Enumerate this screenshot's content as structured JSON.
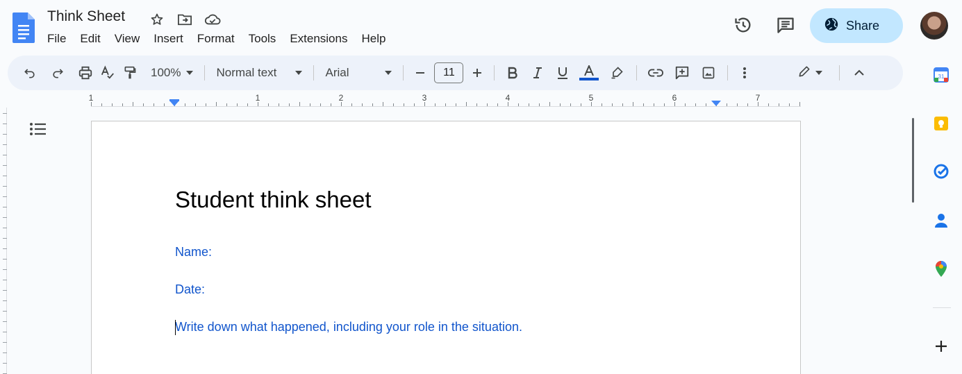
{
  "header": {
    "title": "Think Sheet",
    "menus": [
      "File",
      "Edit",
      "View",
      "Insert",
      "Format",
      "Tools",
      "Extensions",
      "Help"
    ],
    "share_label": "Share"
  },
  "toolbar": {
    "zoom": "100%",
    "style": "Normal text",
    "font": "Arial",
    "font_size": "11"
  },
  "ruler": {
    "numbers": [
      "1",
      "1",
      "2",
      "3",
      "4",
      "5",
      "6",
      "7"
    ]
  },
  "document": {
    "heading": "Student think sheet",
    "lines": [
      "Name:",
      "Date:",
      "Write down what happened, including your role in the situation."
    ]
  },
  "colors": {
    "accent": "#c2e7ff",
    "link_text": "#1155cc",
    "toolbar_bg": "#edf2fa"
  }
}
